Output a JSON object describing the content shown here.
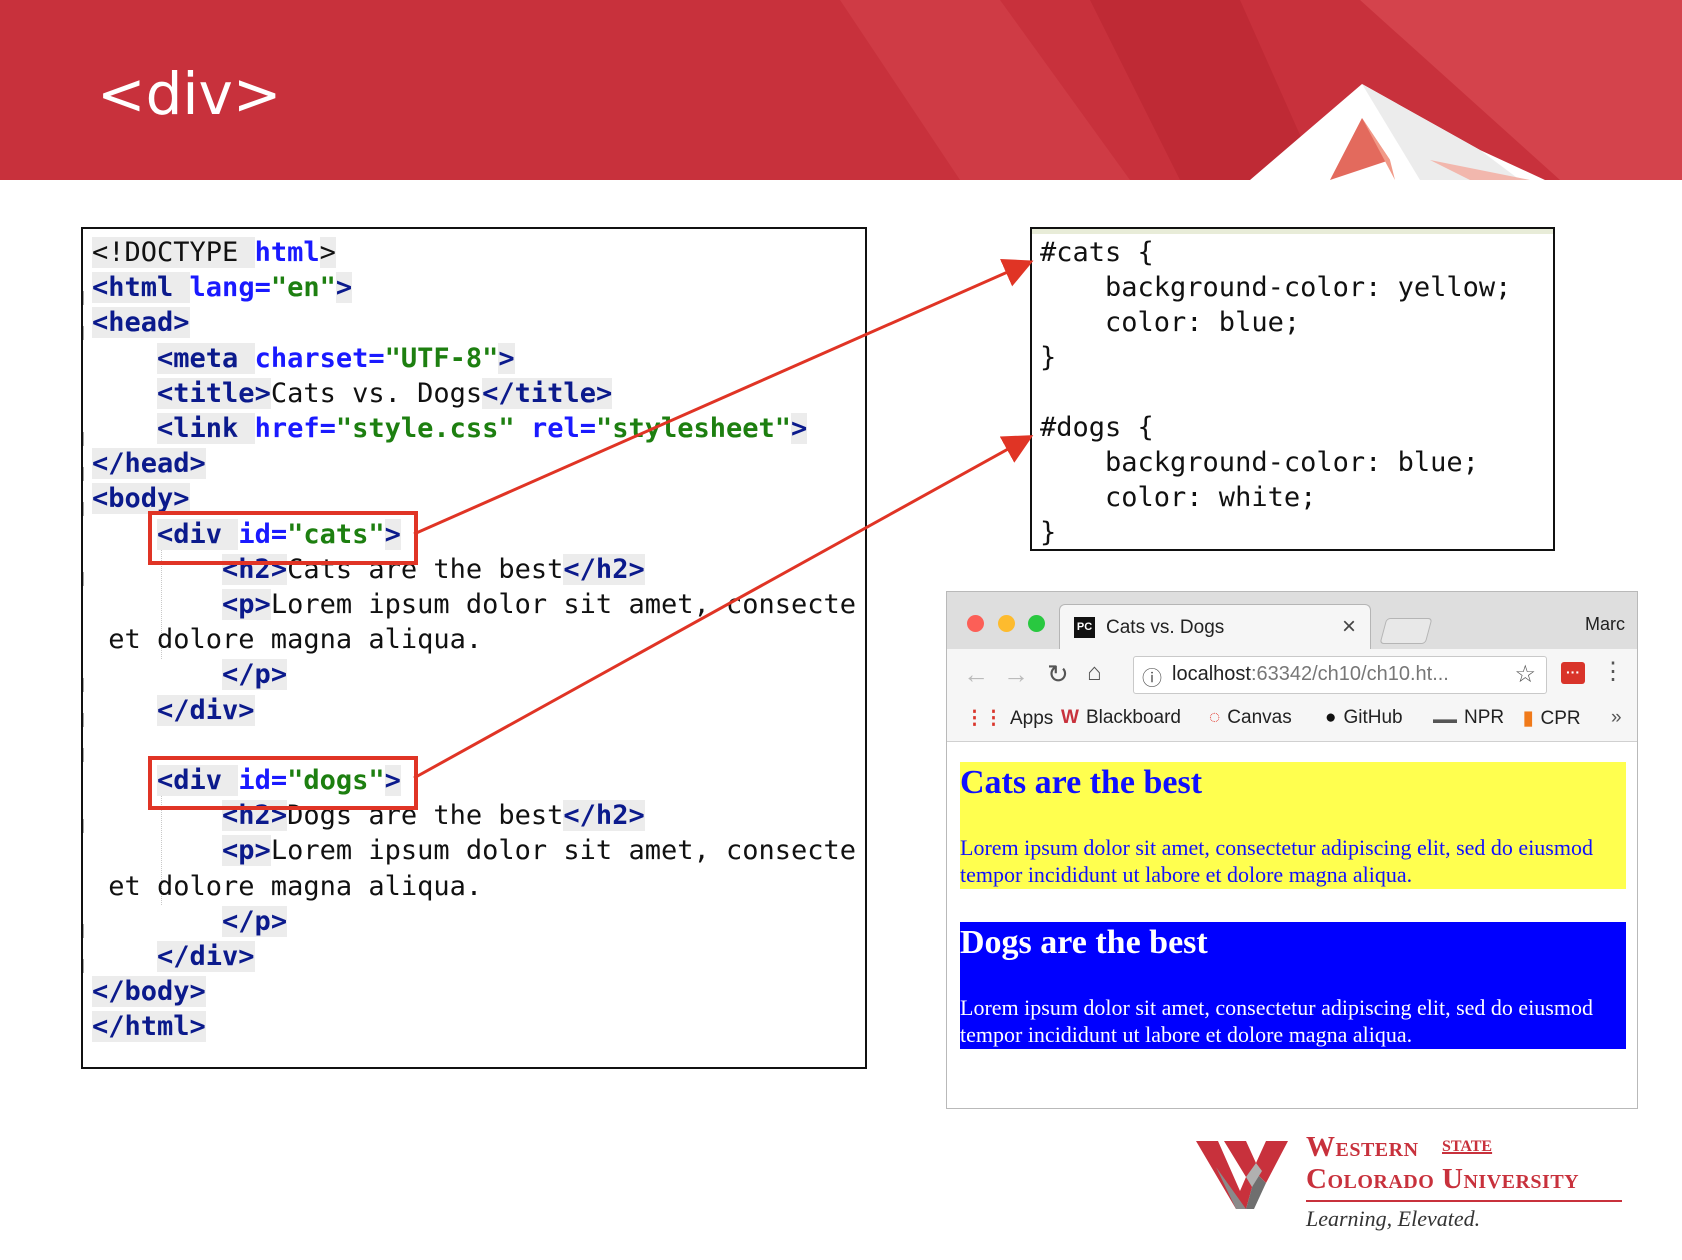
{
  "slide": {
    "title": "<div>"
  },
  "html_code": {
    "lines": [
      "<!DOCTYPE html>",
      "<html lang=\"en\">",
      "<head>",
      "    <meta charset=\"UTF-8\">",
      "    <title>Cats vs. Dogs</title>",
      "    <link href=\"style.css\" rel=\"stylesheet\">",
      "</head>",
      "<body>",
      "    <div id=\"cats\">",
      "        <h2>Cats are the best</h2>",
      "        <p>Lorem ipsum dolor sit amet, consecte",
      " et dolore magna aliqua.",
      "        </p>",
      "    </div>",
      "",
      "    <div id=\"dogs\">",
      "        <h2>Dogs are the best</h2>",
      "        <p>Lorem ipsum dolor sit amet, consecte",
      " et dolore magna aliqua.",
      "        </p>",
      "    </div>",
      "</body>",
      "</html>"
    ]
  },
  "css_code": {
    "lines": [
      "#cats {",
      "    background-color: yellow;",
      "    color: blue;",
      "}",
      "",
      "#dogs {",
      "    background-color: blue;",
      "    color: white;",
      "}"
    ]
  },
  "browser": {
    "tab_title": "Cats vs. Dogs",
    "tab_favicon": "PC",
    "tab_close": "×",
    "profile": "Marc",
    "url_host": "localhost",
    "url_rest": ":63342/ch10/ch10.ht...",
    "bookmarks": [
      {
        "label": "Apps",
        "icon": "apps-grid-icon"
      },
      {
        "label": "Blackboard",
        "icon": "blackboard-icon"
      },
      {
        "label": "Canvas",
        "icon": "canvas-icon"
      },
      {
        "label": "GitHub",
        "icon": "github-icon"
      },
      {
        "label": "NPR",
        "icon": "npr-icon"
      },
      {
        "label": "CPR",
        "icon": "cpr-icon"
      }
    ],
    "bookmarks_more": "»",
    "rendered": {
      "cats_heading": "Cats are the best",
      "cats_text": "Lorem ipsum dolor sit amet, consectetur adipiscing elit, sed do eiusmod tempor incididunt ut labore et dolore magna aliqua.",
      "dogs_heading": "Dogs are the best",
      "dogs_text": "Lorem ipsum dolor sit amet, consectetur adipiscing elit, sed do eiusmod tempor incididunt ut labore et dolore magna aliqua."
    }
  },
  "logo": {
    "line1": "Western",
    "state": "STATE",
    "line2": "Colorado University",
    "tagline": "Learning, Elevated."
  },
  "colors": {
    "brand_red": "#c8313c",
    "arrow_red": "#e03425",
    "cats_bg": "#ffff4f",
    "cats_fg": "#1010ff",
    "dogs_bg": "#0000ff",
    "dogs_fg": "#ffffff"
  }
}
